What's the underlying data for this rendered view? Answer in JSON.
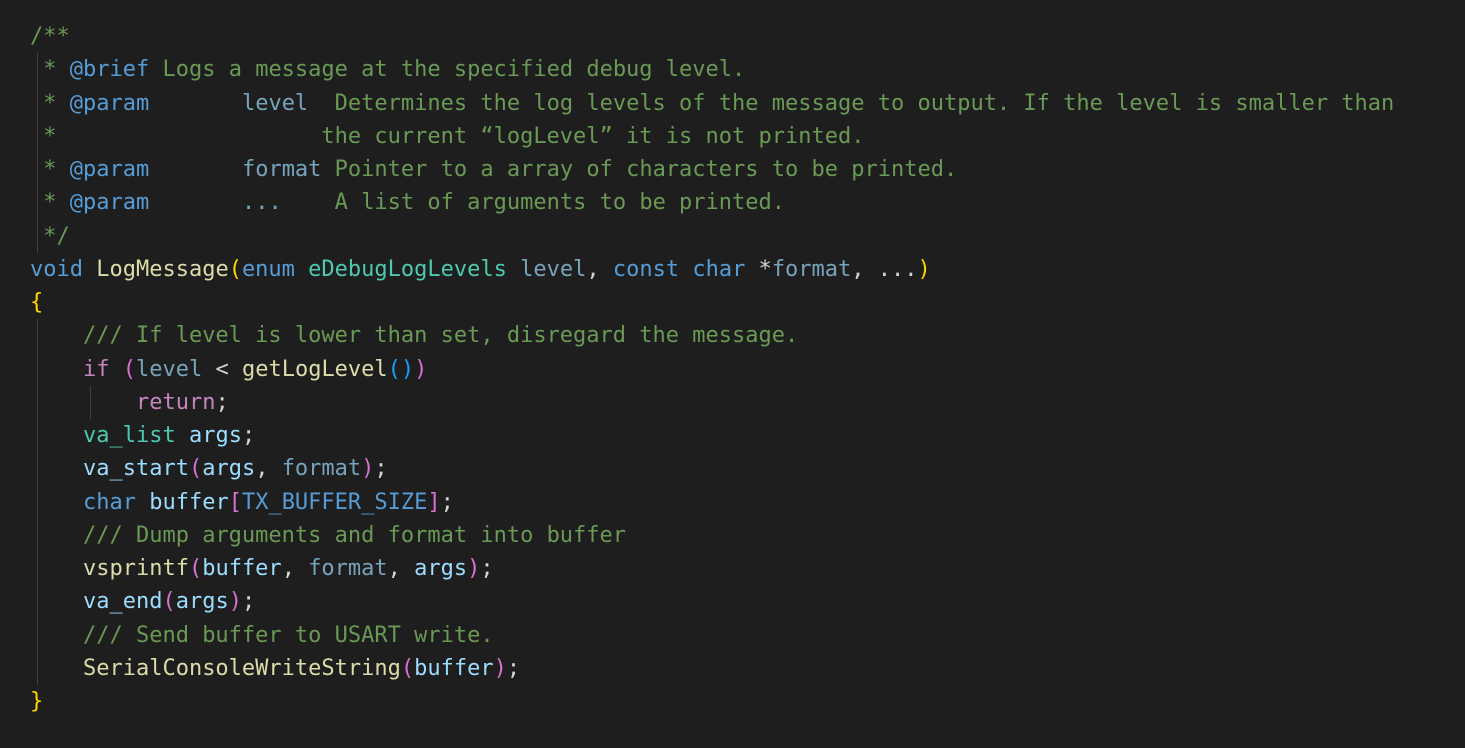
{
  "editor": {
    "language": "c",
    "colors": {
      "background": "#1e1e1e",
      "comment": "#6a9955",
      "keyword": "#569cd6",
      "control": "#c586c0",
      "function": "#dcdcaa",
      "type": "#4ec9b0",
      "variable": "#9cdcfe",
      "bracket_level_1": "#ffd700",
      "bracket_level_2": "#da70d6",
      "bracket_level_3": "#179fff"
    },
    "lines": [
      {
        "guides": [],
        "tokens": [
          {
            "t": "/**",
            "c": "comment"
          }
        ]
      },
      {
        "guides": [
          0
        ],
        "tokens": [
          {
            "t": " * ",
            "c": "comment"
          },
          {
            "t": "@brief",
            "c": "doctag"
          },
          {
            "t": " Logs a message at the specified debug level.",
            "c": "comment"
          }
        ]
      },
      {
        "guides": [
          0
        ],
        "tokens": [
          {
            "t": " * ",
            "c": "comment"
          },
          {
            "t": "@param",
            "c": "doctag"
          },
          {
            "t": "       ",
            "c": "comment"
          },
          {
            "t": "level",
            "c": "param"
          },
          {
            "t": "  Determines the log levels of the message to output. If the level is smaller than",
            "c": "comment"
          }
        ]
      },
      {
        "guides": [
          0
        ],
        "tokens": [
          {
            "t": " *                    the current “logLevel” it is not printed.",
            "c": "comment"
          }
        ]
      },
      {
        "guides": [
          0
        ],
        "tokens": [
          {
            "t": " * ",
            "c": "comment"
          },
          {
            "t": "@param",
            "c": "doctag"
          },
          {
            "t": "       ",
            "c": "comment"
          },
          {
            "t": "format",
            "c": "param"
          },
          {
            "t": " Pointer to a array of characters to be printed.",
            "c": "comment"
          }
        ]
      },
      {
        "guides": [
          0
        ],
        "tokens": [
          {
            "t": " * ",
            "c": "comment"
          },
          {
            "t": "@param",
            "c": "doctag"
          },
          {
            "t": "       ",
            "c": "comment"
          },
          {
            "t": "...",
            "c": "param"
          },
          {
            "t": "    A list of arguments to be printed.",
            "c": "comment"
          }
        ]
      },
      {
        "guides": [
          0
        ],
        "tokens": [
          {
            "t": " */",
            "c": "comment"
          }
        ]
      },
      {
        "guides": [],
        "tokens": [
          {
            "t": "void",
            "c": "keyword"
          },
          {
            "t": " ",
            "c": "plain"
          },
          {
            "t": "LogMessage",
            "c": "func"
          },
          {
            "t": "(",
            "c": "b1"
          },
          {
            "t": "enum",
            "c": "keyword"
          },
          {
            "t": " ",
            "c": "plain"
          },
          {
            "t": "eDebugLogLevels",
            "c": "type"
          },
          {
            "t": " ",
            "c": "plain"
          },
          {
            "t": "level",
            "c": "param"
          },
          {
            "t": ", ",
            "c": "plain"
          },
          {
            "t": "const",
            "c": "keyword"
          },
          {
            "t": " ",
            "c": "plain"
          },
          {
            "t": "char",
            "c": "keyword"
          },
          {
            "t": " *",
            "c": "plain"
          },
          {
            "t": "format",
            "c": "param"
          },
          {
            "t": ", ...",
            "c": "plain"
          },
          {
            "t": ")",
            "c": "b1"
          }
        ]
      },
      {
        "guides": [],
        "tokens": [
          {
            "t": "{",
            "c": "b1"
          }
        ]
      },
      {
        "guides": [
          0
        ],
        "tokens": [
          {
            "t": "    ",
            "c": "plain"
          },
          {
            "t": "/// If level is lower than set, disregard the message.",
            "c": "comment"
          }
        ]
      },
      {
        "guides": [
          0
        ],
        "tokens": [
          {
            "t": "    ",
            "c": "plain"
          },
          {
            "t": "if",
            "c": "control"
          },
          {
            "t": " ",
            "c": "plain"
          },
          {
            "t": "(",
            "c": "b2"
          },
          {
            "t": "level",
            "c": "param"
          },
          {
            "t": " < ",
            "c": "plain"
          },
          {
            "t": "getLogLevel",
            "c": "func"
          },
          {
            "t": "()",
            "c": "b3"
          },
          {
            "t": ")",
            "c": "b2"
          }
        ]
      },
      {
        "guides": [
          0,
          4
        ],
        "tokens": [
          {
            "t": "        ",
            "c": "plain"
          },
          {
            "t": "return",
            "c": "control"
          },
          {
            "t": ";",
            "c": "plain"
          }
        ]
      },
      {
        "guides": [
          0
        ],
        "tokens": [
          {
            "t": "    ",
            "c": "plain"
          },
          {
            "t": "va_list",
            "c": "type"
          },
          {
            "t": " ",
            "c": "plain"
          },
          {
            "t": "args",
            "c": "var"
          },
          {
            "t": ";",
            "c": "plain"
          }
        ]
      },
      {
        "guides": [
          0
        ],
        "tokens": [
          {
            "t": "    ",
            "c": "plain"
          },
          {
            "t": "va_start",
            "c": "var"
          },
          {
            "t": "(",
            "c": "b2"
          },
          {
            "t": "args",
            "c": "var"
          },
          {
            "t": ", ",
            "c": "plain"
          },
          {
            "t": "format",
            "c": "param"
          },
          {
            "t": ")",
            "c": "b2"
          },
          {
            "t": ";",
            "c": "plain"
          }
        ]
      },
      {
        "guides": [
          0
        ],
        "tokens": [
          {
            "t": "    ",
            "c": "plain"
          },
          {
            "t": "char",
            "c": "keyword"
          },
          {
            "t": " ",
            "c": "plain"
          },
          {
            "t": "buffer",
            "c": "var"
          },
          {
            "t": "[",
            "c": "b2"
          },
          {
            "t": "TX_BUFFER_SIZE",
            "c": "macro"
          },
          {
            "t": "]",
            "c": "b2"
          },
          {
            "t": ";",
            "c": "plain"
          }
        ]
      },
      {
        "guides": [
          0
        ],
        "tokens": [
          {
            "t": "    ",
            "c": "plain"
          },
          {
            "t": "/// Dump arguments and format into buffer",
            "c": "comment"
          }
        ]
      },
      {
        "guides": [
          0
        ],
        "tokens": [
          {
            "t": "    ",
            "c": "plain"
          },
          {
            "t": "vsprintf",
            "c": "func"
          },
          {
            "t": "(",
            "c": "b2"
          },
          {
            "t": "buffer",
            "c": "var"
          },
          {
            "t": ", ",
            "c": "plain"
          },
          {
            "t": "format",
            "c": "param"
          },
          {
            "t": ", ",
            "c": "plain"
          },
          {
            "t": "args",
            "c": "var"
          },
          {
            "t": ")",
            "c": "b2"
          },
          {
            "t": ";",
            "c": "plain"
          }
        ]
      },
      {
        "guides": [
          0
        ],
        "tokens": [
          {
            "t": "    ",
            "c": "plain"
          },
          {
            "t": "va_end",
            "c": "var"
          },
          {
            "t": "(",
            "c": "b2"
          },
          {
            "t": "args",
            "c": "var"
          },
          {
            "t": ")",
            "c": "b2"
          },
          {
            "t": ";",
            "c": "plain"
          }
        ]
      },
      {
        "guides": [
          0
        ],
        "tokens": [
          {
            "t": "    ",
            "c": "plain"
          },
          {
            "t": "/// Send buffer to USART write.",
            "c": "comment"
          }
        ]
      },
      {
        "guides": [
          0
        ],
        "tokens": [
          {
            "t": "    ",
            "c": "plain"
          },
          {
            "t": "SerialConsoleWriteString",
            "c": "func"
          },
          {
            "t": "(",
            "c": "b2"
          },
          {
            "t": "buffer",
            "c": "var"
          },
          {
            "t": ")",
            "c": "b2"
          },
          {
            "t": ";",
            "c": "plain"
          }
        ]
      },
      {
        "guides": [],
        "tokens": [
          {
            "t": "}",
            "c": "b1"
          }
        ]
      }
    ]
  }
}
